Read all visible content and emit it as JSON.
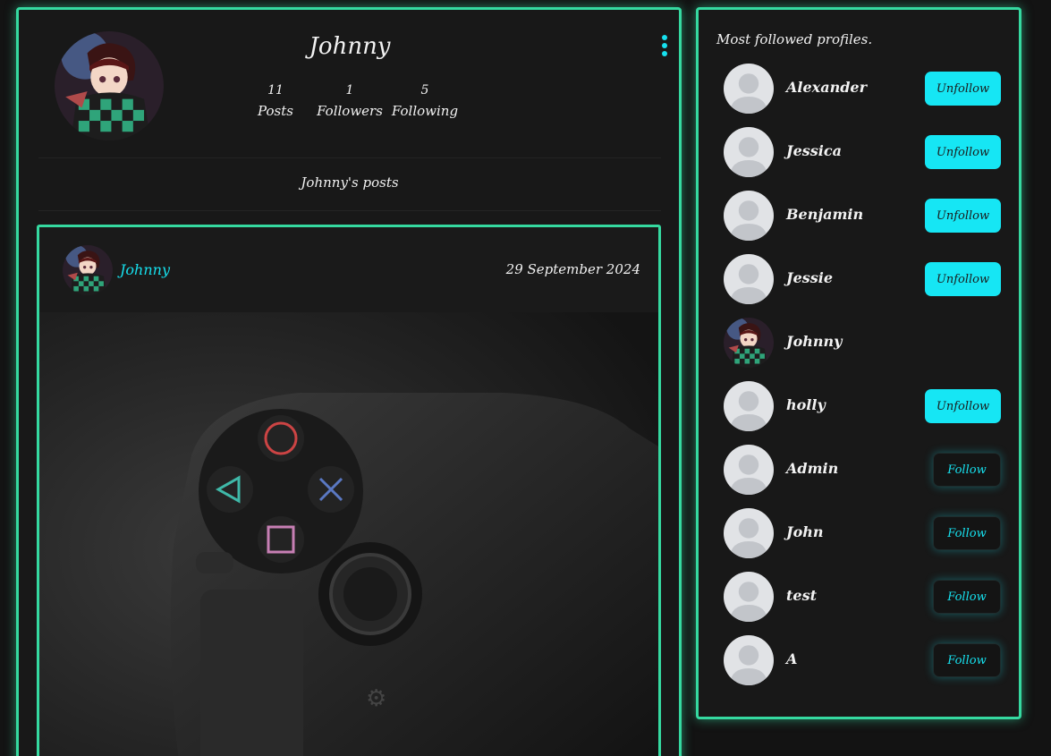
{
  "profile": {
    "name": "Johnny",
    "stats": [
      {
        "value": "11",
        "label": "Posts"
      },
      {
        "value": "1",
        "label": "Followers"
      },
      {
        "value": "5",
        "label": "Following"
      }
    ],
    "posts_heading": "Johnny's posts"
  },
  "post": {
    "author": "Johnny",
    "date": "29 September 2024"
  },
  "followed": {
    "title": "Most followed profiles.",
    "users": [
      {
        "name": "Alexander",
        "action": "Unfollow",
        "avatar": "default-avatar"
      },
      {
        "name": "Jessica",
        "action": "Unfollow",
        "avatar": "default-avatar"
      },
      {
        "name": "Benjamin",
        "action": "Unfollow",
        "avatar": "default-avatar"
      },
      {
        "name": "Jessie",
        "action": "Unfollow",
        "avatar": "default-avatar"
      },
      {
        "name": "Johnny",
        "action": "",
        "avatar": "anime-avatar"
      },
      {
        "name": "holly",
        "action": "Unfollow",
        "avatar": "default-avatar"
      },
      {
        "name": "Admin",
        "action": "Follow",
        "avatar": "default-avatar"
      },
      {
        "name": "John",
        "action": "Follow",
        "avatar": "default-avatar"
      },
      {
        "name": "test",
        "action": "Follow",
        "avatar": "default-avatar"
      },
      {
        "name": "A",
        "action": "Follow",
        "avatar": "default-avatar"
      }
    ]
  },
  "colors": {
    "accent": "#35d9a0",
    "cyan": "#16e6f4",
    "background": "#181818"
  }
}
